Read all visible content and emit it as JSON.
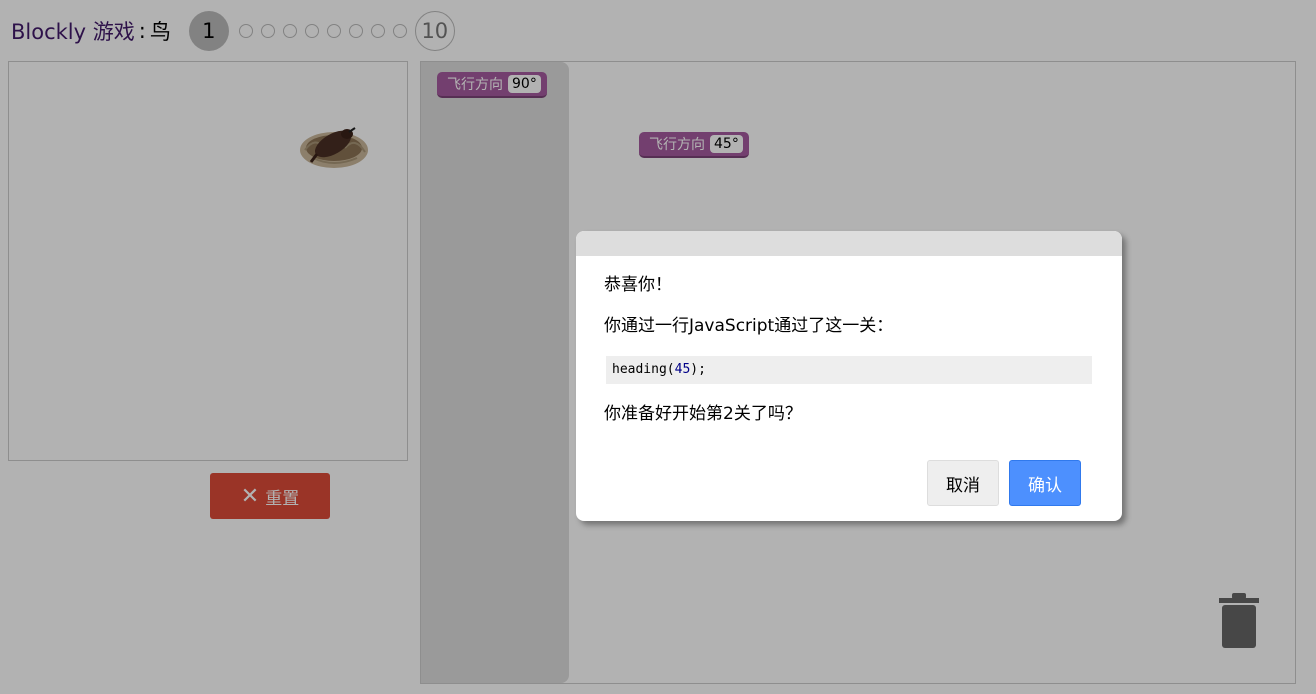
{
  "header": {
    "app_title": "Blockly 游戏",
    "separator": ":",
    "level_name": "鸟",
    "current_level": "1",
    "last_level": "10",
    "level_dots": 8
  },
  "game": {
    "reset_label": "重置",
    "reset_icon": "close-icon"
  },
  "workspace": {
    "flyout_block": {
      "label": "飞行方向",
      "value": "90°"
    },
    "placed_block": {
      "label": "飞行方向",
      "value": "45°"
    }
  },
  "dialog": {
    "congrats": "恭喜你！",
    "message": "你通过一行JavaScript通过了这一关：",
    "code_fn": "heading(",
    "code_arg": "45",
    "code_end": ");",
    "question": "你准备好开始第2关了吗？",
    "cancel_label": "取消",
    "ok_label": "确认"
  },
  "colors": {
    "title": "#421a6b",
    "block": "#a55b9f",
    "reset": "#dd4b39",
    "ok": "#4d90fe"
  }
}
